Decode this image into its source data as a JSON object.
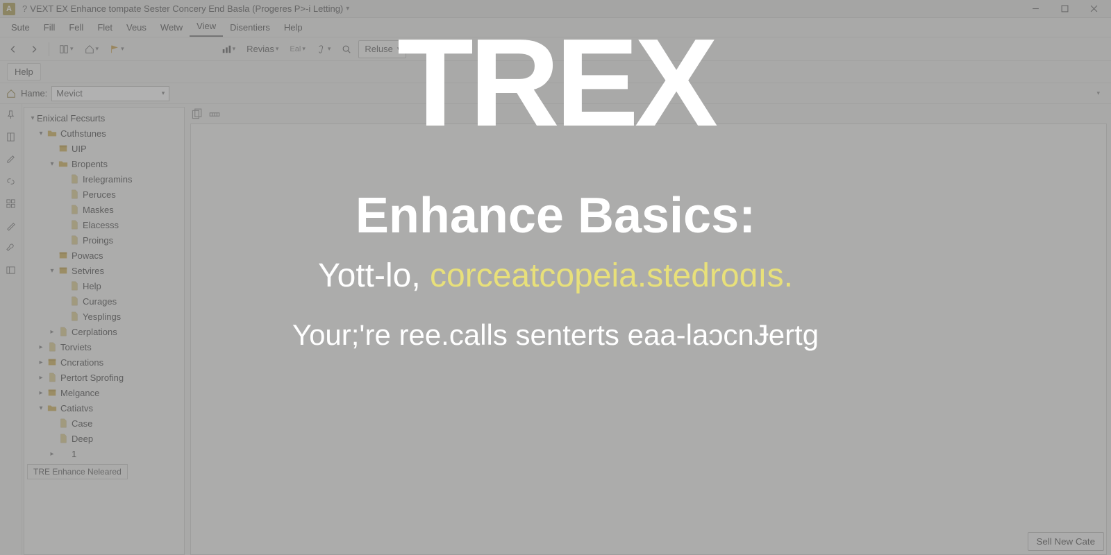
{
  "titlebar": {
    "qmark": "?",
    "title": "VEXT EX Enhance tompate Sester Concery End Basla (Progeres P>-i Letting)"
  },
  "menubar": {
    "items": [
      "Sute",
      "Fill",
      "Fell",
      "Flet",
      "Veus",
      "Wetw",
      "View",
      "Disentiers",
      "Help"
    ],
    "active_index": 6
  },
  "toolbar": {
    "revias": "Revias",
    "small": "Eal",
    "reluse": "Reluse"
  },
  "helpbar": {
    "help": "Help"
  },
  "namerow": {
    "label": "Hame:",
    "value": "Mevict"
  },
  "tree": {
    "root": "Enixical Fecsurts",
    "groups": [
      {
        "label": "Cuthstunes",
        "expanded": true,
        "children": [
          {
            "label": "UIP",
            "icon": "module"
          },
          {
            "label": "Bropents",
            "icon": "folder",
            "expanded": true,
            "children": [
              {
                "label": "Irelegramins",
                "icon": "page"
              },
              {
                "label": "Peruces",
                "icon": "page"
              },
              {
                "label": "Maskes",
                "icon": "page"
              },
              {
                "label": "Elacesss",
                "icon": "page"
              },
              {
                "label": "Proings",
                "icon": "page"
              }
            ]
          },
          {
            "label": "Powacs",
            "icon": "module"
          },
          {
            "label": "Setvires",
            "icon": "module",
            "expanded": true,
            "children": [
              {
                "label": "Help",
                "icon": "page"
              },
              {
                "label": "Curages",
                "icon": "page"
              },
              {
                "label": "Yesplings",
                "icon": "page"
              }
            ]
          },
          {
            "label": "Cerplations",
            "icon": "page",
            "collapsed": true
          }
        ]
      },
      {
        "label": "Torviets",
        "icon": "page",
        "collapsed": true
      },
      {
        "label": "Cncrations",
        "icon": "module",
        "collapsed": true
      },
      {
        "label": "Pertort Sprofing",
        "icon": "page",
        "collapsed": true
      },
      {
        "label": "Melgance",
        "icon": "module",
        "collapsed": true
      },
      {
        "label": "Catiatvs",
        "icon": "folder",
        "expanded": true,
        "children": [
          {
            "label": "Case",
            "icon": "page"
          },
          {
            "label": "Deep",
            "icon": "page"
          },
          {
            "label": "1",
            "icon": "none",
            "collapsed": true
          }
        ]
      }
    ],
    "status": "TRE Enhance Neleared"
  },
  "footer": {
    "button": "Sell New Cate"
  },
  "overlay": {
    "logo": "TREX",
    "subtitle": "Enhance Basics:",
    "line2_a": "Yott-lo, ",
    "line2_b": "corceatcopeia.stedroɑıs.",
    "line3": "Your;'re ree.calls senterts eaa-laͻcnɈertg"
  }
}
